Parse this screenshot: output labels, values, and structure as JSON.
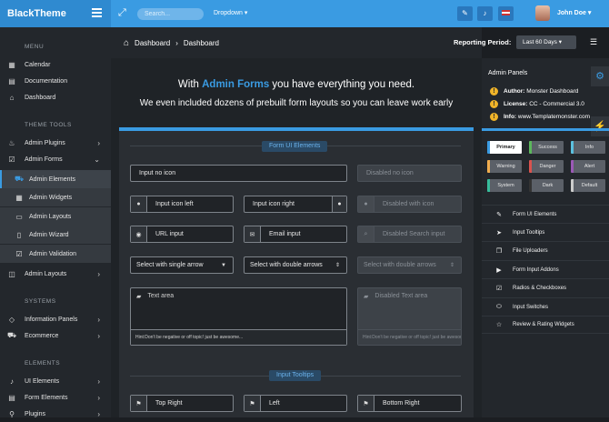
{
  "header": {
    "brand": "BlackTheme",
    "search_placeholder": "Search...",
    "dropdown_label": "Dropdown",
    "user_name": "John Doe"
  },
  "sidebar": {
    "sections": [
      "MENU",
      "THEME TOOLS",
      "SYSTEMS",
      "ELEMENTS"
    ],
    "menu": [
      "Calendar",
      "Documentation",
      "Dashboard"
    ],
    "theme_tools": [
      "Admin Plugins",
      "Admin Forms"
    ],
    "admin_forms_sub": [
      "Admin Elements",
      "Admin Widgets",
      "Admin Layouts",
      "Admin Wizard",
      "Admin Validation"
    ],
    "admin_layouts": "Admin Layouts",
    "systems": [
      "Information Panels",
      "Ecommerce"
    ],
    "elements": [
      "UI Elements",
      "Form Elements",
      "Plugins"
    ]
  },
  "breadcrumb": {
    "root": "Dashboard",
    "current": "Dashboard"
  },
  "reporting": {
    "label": "Reporting Period:",
    "value": "Last 60 Days"
  },
  "hero": {
    "pre": "With ",
    "accent": "Admin Forms",
    "post": " you have everything you need.",
    "sub": "We even included dozens of prebuilt form layouts so you can leave work early"
  },
  "form": {
    "section1": "Form UI Elements",
    "input_no_icon": "Input no icon",
    "disabled_no_icon": "Disabled no icon",
    "input_icon_left": "Input icon left",
    "input_icon_right": "Input icon right",
    "disabled_with_icon": "Disabled with icon",
    "url_input": "URL input",
    "email_input": "Email input",
    "disabled_search": "Disabled Search input",
    "select_single": "Select with single arrow",
    "select_double": "Select with double arrows",
    "select_double_disabled": "Select with double arrows",
    "textarea": "Text area",
    "textarea_disabled": "Disabled Text area",
    "hint": "Hint:Don't be negative or off topic! just be awesome...",
    "section2": "Input Tooltips",
    "top_right": "Top Right",
    "left": "Left",
    "bottom_right": "Bottom Right"
  },
  "right_panel": {
    "title": "Admin Panels",
    "info": [
      {
        "key": "Author:",
        "value": "Monster Dashboard"
      },
      {
        "key": "License:",
        "value": "CC - Commercial 3.0"
      },
      {
        "key": "Info:",
        "value": "www.Templatemonster.com"
      }
    ],
    "color_buttons": [
      "Primary",
      "Success",
      "Info",
      "Warning",
      "Danger",
      "Alert",
      "System",
      "Dark",
      "Default"
    ],
    "links": [
      "Form UI Elements",
      "Input Tooltips",
      "File Uploaders",
      "Form Input Addons",
      "Radios & Checkboxes",
      "Input Switches",
      "Review & Rating Widgets"
    ]
  },
  "colors": {
    "accent": "#3a9be2",
    "sidebar": "#23272c",
    "warning": "#f0b429"
  }
}
